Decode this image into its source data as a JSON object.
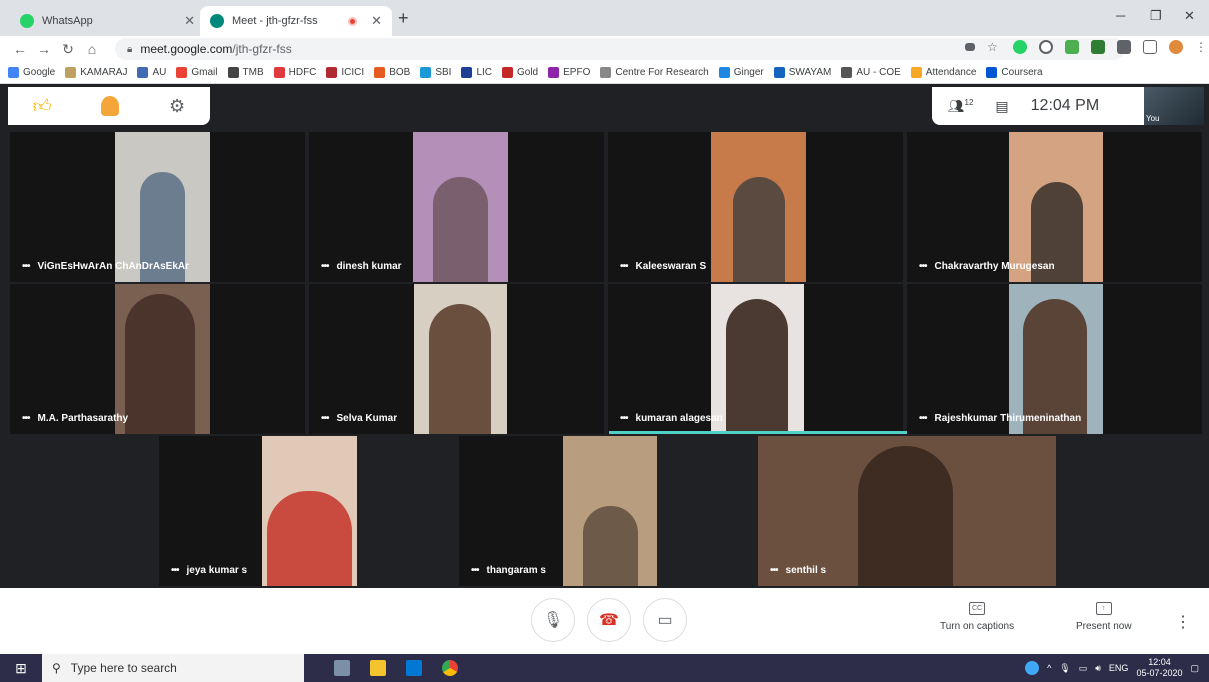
{
  "browser": {
    "tabs": [
      {
        "title": "WhatsApp",
        "active": false,
        "color": "#25d366"
      },
      {
        "title": "Meet - jth-gfzr-fss",
        "active": true,
        "color": "#00897b",
        "recording": true
      }
    ],
    "url_host": "meet.google.com",
    "url_path": "/jth-gfzr-fss",
    "bookmarks": [
      {
        "label": "Google",
        "color": "#4285f4"
      },
      {
        "label": "KAMARAJ",
        "color": "#c0a060"
      },
      {
        "label": "AU",
        "color": "#3f6bb5"
      },
      {
        "label": "Gmail",
        "color": "#ea4335"
      },
      {
        "label": "TMB",
        "color": "#444444"
      },
      {
        "label": "HDFC",
        "color": "#e03a3e"
      },
      {
        "label": "ICICI",
        "color": "#b02a30"
      },
      {
        "label": "BOB",
        "color": "#e65c1f"
      },
      {
        "label": "SBI",
        "color": "#1a9ad6"
      },
      {
        "label": "LIC",
        "color": "#1c3f94"
      },
      {
        "label": "Gold",
        "color": "#c62828"
      },
      {
        "label": "EPFO",
        "color": "#8e24aa"
      },
      {
        "label": "Centre For Research",
        "color": "#888888"
      },
      {
        "label": "Ginger",
        "color": "#1e88e5"
      },
      {
        "label": "SWAYAM",
        "color": "#1565c0"
      },
      {
        "label": "AU - COE",
        "color": "#555555"
      },
      {
        "label": "Attendance",
        "color": "#f9a825"
      },
      {
        "label": "Coursera",
        "color": "#0056d2"
      }
    ]
  },
  "meet": {
    "participant_count": "12",
    "time": "12:04 PM",
    "self_label": "You",
    "participants": [
      {
        "name": "ViGnEsHwArAn ChAnDrAsEkAr",
        "bg": "#6b7d8f"
      },
      {
        "name": "dinesh kumar",
        "bg": "#7a5f6e"
      },
      {
        "name": "Kaleeswaran S",
        "bg": "#8a6b50"
      },
      {
        "name": "Chakravarthy Murugesan",
        "bg": "#9a7b62"
      },
      {
        "name": "M.A. Parthasarathy",
        "bg": "#6a4a3e"
      },
      {
        "name": "Selva Kumar",
        "bg": "#8a8070"
      },
      {
        "name": "kumaran alagesan",
        "bg": "#5a4a40"
      },
      {
        "name": "Rajeshkumar Thirumeninathan",
        "bg": "#6d8a9a"
      },
      {
        "name": "jeya kumar s",
        "bg": "#a06a50"
      },
      {
        "name": "thangaram s",
        "bg": "#a0907a"
      },
      {
        "name": "senthil s",
        "bg": "#6b5040"
      }
    ],
    "captions_label": "Turn on captions",
    "present_label": "Present now"
  },
  "taskbar": {
    "search_placeholder": "Type here to search",
    "lang": "ENG",
    "time": "12:04",
    "date": "05-07-2020"
  }
}
